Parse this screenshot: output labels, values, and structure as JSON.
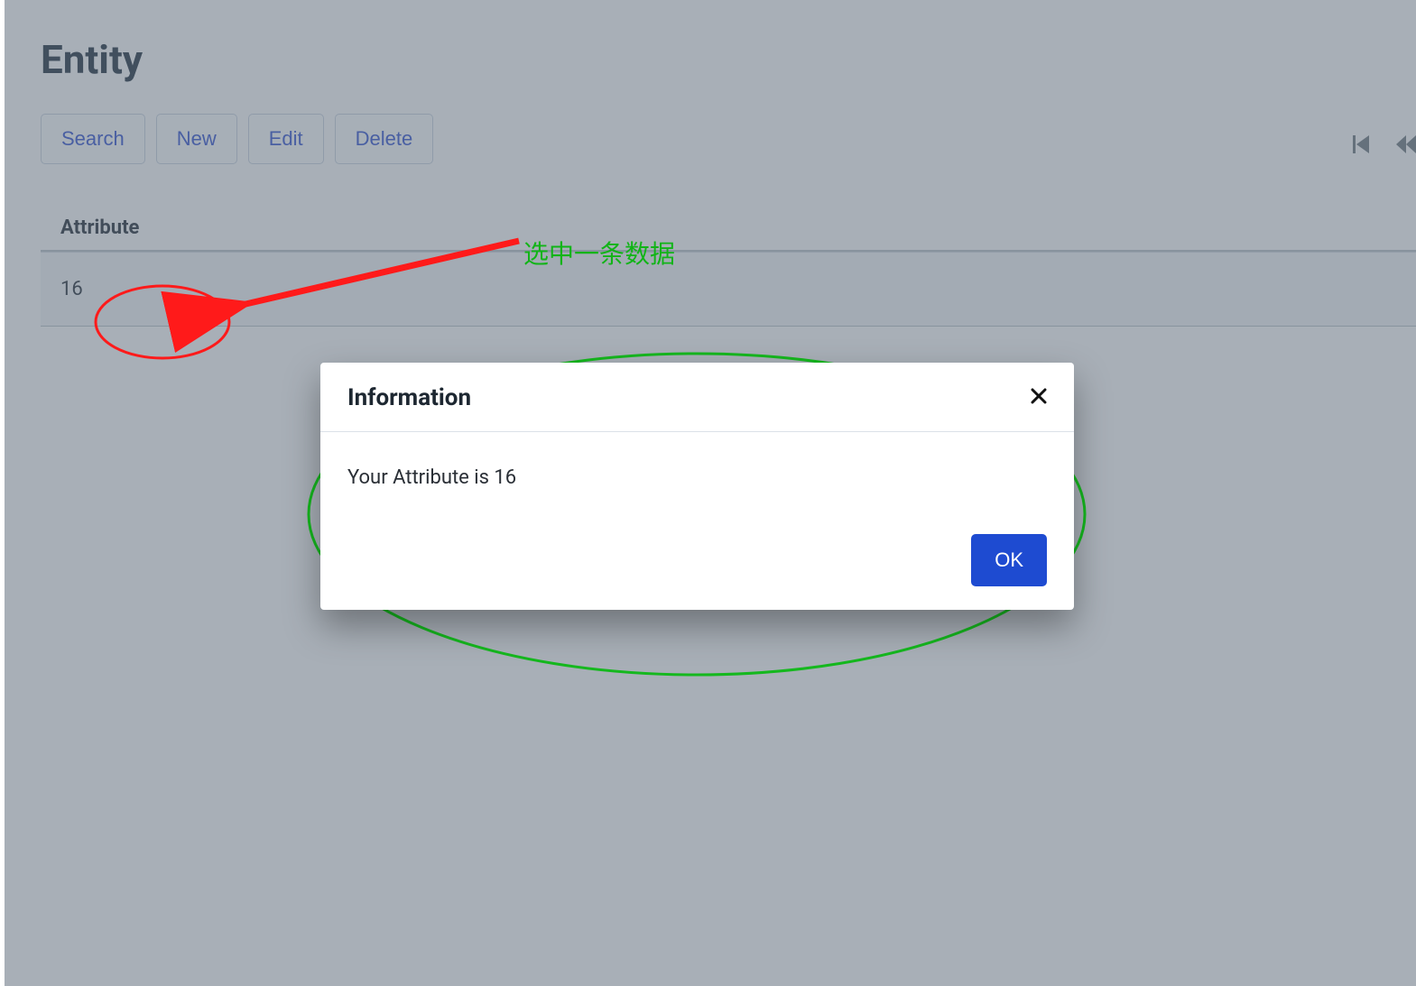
{
  "header": {
    "title": "Entity"
  },
  "toolbar": {
    "search_label": "Search",
    "new_label": "New",
    "edit_label": "Edit",
    "delete_label": "Delete"
  },
  "table": {
    "columns": [
      {
        "label": "Attribute"
      }
    ],
    "rows": [
      {
        "attribute": "16"
      }
    ]
  },
  "annotation": {
    "select_row_hint": "选中一条数据"
  },
  "dialog": {
    "title": "Information",
    "message": "Your Attribute is 16",
    "ok_label": "OK"
  }
}
